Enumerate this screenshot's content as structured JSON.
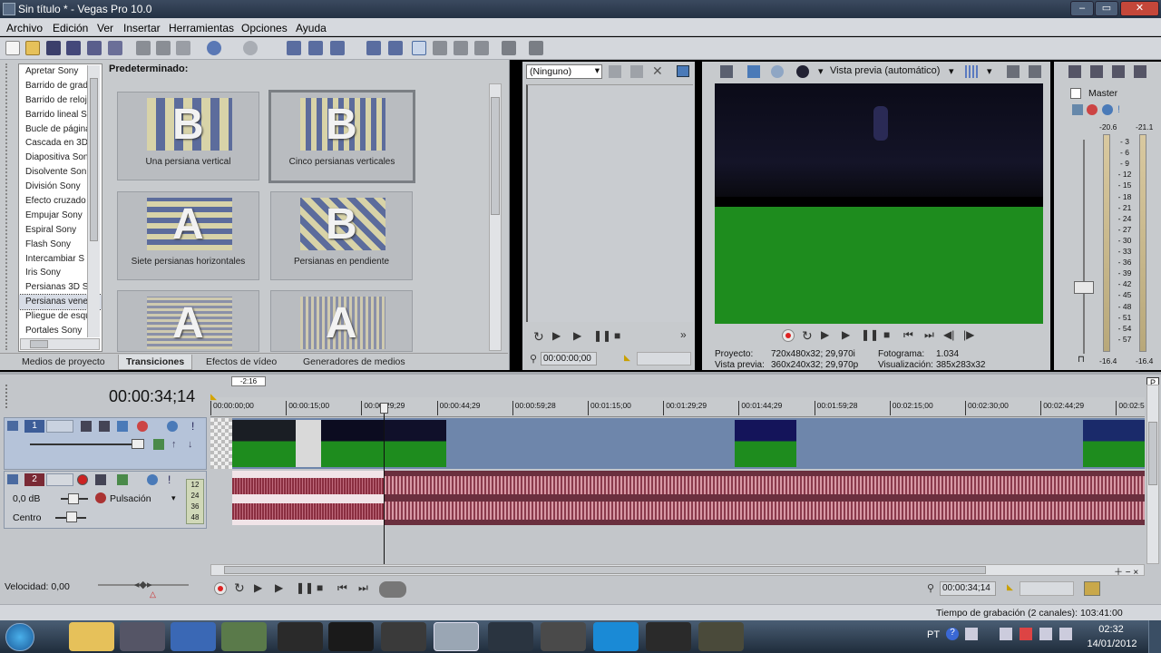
{
  "window": {
    "title": "Sin título * - Vegas Pro 10.0"
  },
  "menu": [
    "Archivo",
    "Edición",
    "Ver",
    "Insertar",
    "Herramientas",
    "Opciones",
    "Ayuda"
  ],
  "left_list": {
    "items": [
      "Apretar Sony",
      "Barrido de grad",
      "Barrido de reloj",
      "Barrido lineal S",
      "Bucle de página",
      "Cascada en 3D",
      "Diapositiva Son",
      "Disolvente Son",
      "División Sony",
      "Efecto cruzado",
      "Empujar Sony",
      "Espiral Sony",
      "Flash Sony",
      "Intercambiar S",
      "Iris Sony",
      "Persianas 3D S",
      "Persianas vene",
      "Pliegue de esqu",
      "Portales Sony"
    ],
    "selected_index": 16
  },
  "transitions": {
    "heading": "Predeterminado:",
    "presets": [
      "Una persiana vertical",
      "Cinco persianas verticales",
      "Siete persianas horizontales",
      "Persianas en pendiente"
    ],
    "selected_index": 1
  },
  "bottom_tabs": [
    "Medios de proyecto",
    "Transiciones",
    "Efectos de vídeo",
    "Generadores de medios"
  ],
  "active_tab": "Transiciones",
  "trimmer": {
    "dropdown": "(Ninguno)",
    "timecode": "00:00:00;00"
  },
  "preview": {
    "mode": "Vista previa (automático)",
    "proyecto_label": "Proyecto:",
    "proyecto": "720x480x32; 29,970i",
    "vista_label": "Vista previa:",
    "vista": "360x240x32; 29,970p",
    "fotograma_label": "Fotograma:",
    "fotograma": "1.034",
    "visualizacion_label": "Visualización:",
    "visualizacion": "385x283x32"
  },
  "master": {
    "label": "Master",
    "left_peak": "-20.6",
    "right_peak": "-21.1",
    "scale": [
      "3",
      "6",
      "9",
      "12",
      "15",
      "18",
      "21",
      "24",
      "27",
      "30",
      "33",
      "36",
      "39",
      "42",
      "45",
      "48",
      "51",
      "54",
      "57"
    ],
    "left_level": "-16.4",
    "right_level": "-16.4"
  },
  "timeline": {
    "cursor_time": "00:00:34;14",
    "marker": "-2:16",
    "ruler": [
      "00:00:00;00",
      "00:00:15;00",
      "00:00:29;29",
      "00:00:44;29",
      "00:00:59;28",
      "00:01:15;00",
      "00:01:29;29",
      "00:01:44;29",
      "00:01:59;28",
      "00:02:15;00",
      "00:02:30;00",
      "00:02:44;29",
      "00:02:5"
    ],
    "video_track_num": "1",
    "audio_track_num": "2",
    "audio_vol": "0,0 dB",
    "audio_pan": "Centro",
    "audio_mode": "Pulsación",
    "meter_vals": [
      "12",
      "24",
      "36",
      "48"
    ],
    "velocity": "Velocidad: 0,00",
    "end_time": "00:00:34;14",
    "record_time": "Tiempo de grabación (2 canales): 103:41:00"
  },
  "taskbar": {
    "lang": "PT",
    "time": "02:32",
    "date": "14/01/2012"
  },
  "colors": {
    "green_screen": "#1e8c1e",
    "video_track": "#6e86ab",
    "audio_track": "#6a2f3e",
    "waveform": "#d89aa6"
  }
}
